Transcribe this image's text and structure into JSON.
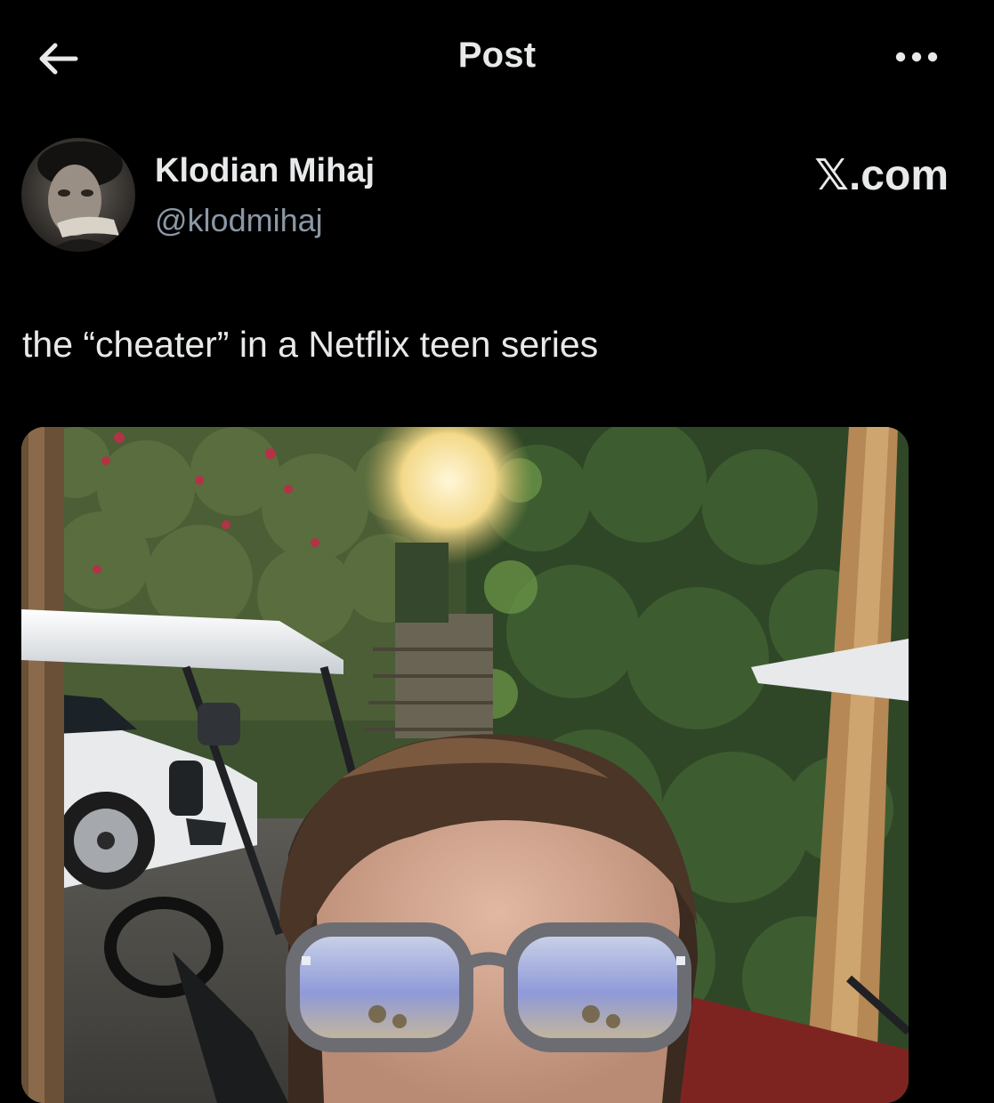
{
  "header": {
    "title": "Post"
  },
  "author": {
    "display_name": "Klodian Mihaj",
    "handle": "@klodmihaj"
  },
  "watermark": "𝕏.com",
  "post": {
    "text": "the “cheater” in a Netflix teen series"
  },
  "icons": {
    "back": "back-arrow-icon",
    "more": "more-options-icon"
  },
  "colors": {
    "background": "#000000",
    "text_primary": "#e7e9ea",
    "text_secondary": "#8b98a5"
  }
}
